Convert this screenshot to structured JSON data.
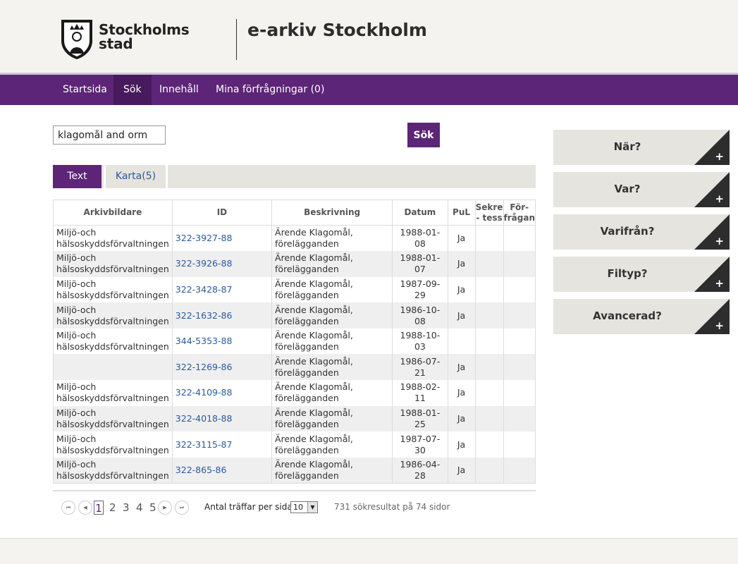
{
  "header": {
    "logo_line1": "Stockholms",
    "logo_line2": "stad",
    "site_title": "e-arkiv Stockholm"
  },
  "nav": {
    "items": [
      {
        "label": "Startsida"
      },
      {
        "label": "Sök"
      },
      {
        "label": "Innehåll"
      },
      {
        "label": "Mina förfrågningar (0)"
      }
    ],
    "active": "Sök"
  },
  "search": {
    "value": "klagomål and orm",
    "button_label": "Sök"
  },
  "tabs": [
    {
      "label": "Text"
    },
    {
      "label": "Karta(5)"
    }
  ],
  "table": {
    "headers": {
      "arkivbildare": "Arkivbildare",
      "id": "ID",
      "beskrivning": "Beskrivning",
      "datum": "Datum",
      "pul": "PuL",
      "sekretess_1": "Sekre",
      "sekretess_2": "- tess",
      "forfragan_1": "För-",
      "forfragan_2": "frågan"
    },
    "rows": [
      {
        "arkivbildare_1": "Miljö-och",
        "arkivbildare_2": "hälsoskyddsförvaltningen",
        "id": "322-3927-88",
        "beskrivning_1": "Ärende Klagomål,",
        "beskrivning_2": "förelägganden",
        "datum": "1988-01-08",
        "pul": "Ja"
      },
      {
        "arkivbildare_1": "Miljö-och",
        "arkivbildare_2": "hälsoskyddsförvaltningen",
        "id": "322-3926-88",
        "beskrivning_1": "Ärende Klagomål,",
        "beskrivning_2": "förelägganden",
        "datum": "1988-01-07",
        "pul": "Ja"
      },
      {
        "arkivbildare_1": "Miljö-och",
        "arkivbildare_2": "hälsoskyddsförvaltningen",
        "id": "322-3428-87",
        "beskrivning_1": "Ärende Klagomål,",
        "beskrivning_2": "förelägganden",
        "datum": "1987-09-29",
        "pul": "Ja"
      },
      {
        "arkivbildare_1": "Miljö-och",
        "arkivbildare_2": "hälsoskyddsförvaltningen",
        "id": "322-1632-86",
        "beskrivning_1": "Ärende Klagomål,",
        "beskrivning_2": "förelägganden",
        "datum": "1986-10-08",
        "pul": "Ja"
      },
      {
        "arkivbildare_1": "Miljö-och",
        "arkivbildare_2": "hälsoskyddsförvaltningen",
        "id": "344-5353-88",
        "beskrivning_1": "Ärende Klagomål,",
        "beskrivning_2": "förelägganden",
        "datum": "1988-10-03",
        "pul": ""
      },
      {
        "arkivbildare_1": "",
        "arkivbildare_2": "",
        "id": "322-1269-86",
        "beskrivning_1": "Ärende Klagomål,",
        "beskrivning_2": "förelägganden",
        "datum": "1986-07-21",
        "pul": "Ja"
      },
      {
        "arkivbildare_1": "Miljö-och",
        "arkivbildare_2": "hälsoskyddsförvaltningen",
        "id": "322-4109-88",
        "beskrivning_1": "Ärende Klagomål,",
        "beskrivning_2": "förelägganden",
        "datum": "1988-02-11",
        "pul": "Ja"
      },
      {
        "arkivbildare_1": "Miljö-och",
        "arkivbildare_2": "hälsoskyddsförvaltningen",
        "id": "322-4018-88",
        "beskrivning_1": "Ärende Klagomål,",
        "beskrivning_2": "förelägganden",
        "datum": "1988-01-25",
        "pul": "Ja"
      },
      {
        "arkivbildare_1": "Miljö-och",
        "arkivbildare_2": "hälsoskyddsförvaltningen",
        "id": "322-3115-87",
        "beskrivning_1": "Ärende Klagomål,",
        "beskrivning_2": "förelägganden",
        "datum": "1987-07-30",
        "pul": "Ja"
      },
      {
        "arkivbildare_1": "Miljö-och",
        "arkivbildare_2": "hälsoskyddsförvaltningen",
        "id": "322-865-86",
        "beskrivning_1": "Ärende Klagomål,",
        "beskrivning_2": "förelägganden",
        "datum": "1986-04-28",
        "pul": "Ja"
      }
    ]
  },
  "pager": {
    "first_icon": "first-page-icon",
    "prev_icon": "prev-page-icon",
    "next_icon": "next-page-icon",
    "last_icon": "last-page-icon",
    "pages": [
      "1",
      "2",
      "3",
      "4",
      "5"
    ],
    "current": "1",
    "per_page_label": "Antal träffar per sida:",
    "per_page_value": "10",
    "result_count": "731 sökresultat på 74 sidor"
  },
  "filters": [
    {
      "label": "När?"
    },
    {
      "label": "Var?"
    },
    {
      "label": "Varifrån?"
    },
    {
      "label": "Filtyp?"
    },
    {
      "label": "Avancerad?"
    }
  ],
  "colors": {
    "brand_purple": "#5c2577",
    "link_blue": "#2a5a9a",
    "filter_bg": "#e6e4df"
  }
}
